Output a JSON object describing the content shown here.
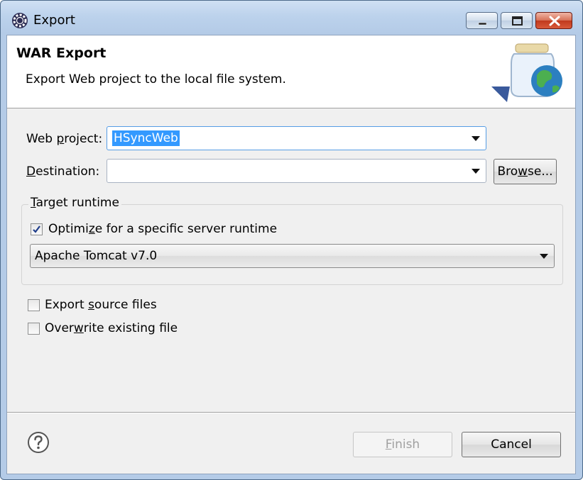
{
  "window": {
    "title": "Export",
    "icon": "eclipse-gear-icon"
  },
  "banner": {
    "title": "WAR Export",
    "description": "Export Web project to the local file system.",
    "icon": "jar-globe-wizard-icon"
  },
  "form": {
    "web_project_label_pre": "Web ",
    "web_project_label_mn": "p",
    "web_project_label_post": "roject:",
    "web_project_value": "HSyncWeb",
    "destination_label_mn": "D",
    "destination_label_post": "estination:",
    "destination_value": "",
    "browse_pre": "Bro",
    "browse_mn": "w",
    "browse_post": "se..."
  },
  "target_runtime": {
    "group_label_mn": "T",
    "group_label_post": "arget runtime",
    "optimize_pre": "Optimi",
    "optimize_mn": "z",
    "optimize_post": "e for a specific server runtime",
    "optimize_checked": true,
    "runtime_value": "Apache Tomcat v7.0"
  },
  "options": {
    "export_source_pre": "Export ",
    "export_source_mn": "s",
    "export_source_post": "ource files",
    "export_source_checked": false,
    "overwrite_pre": "Over",
    "overwrite_mn": "w",
    "overwrite_post": "rite existing file",
    "overwrite_checked": false
  },
  "footer": {
    "finish_mn": "F",
    "finish_post": "inish",
    "finish_enabled": false,
    "cancel_label": "Cancel"
  }
}
